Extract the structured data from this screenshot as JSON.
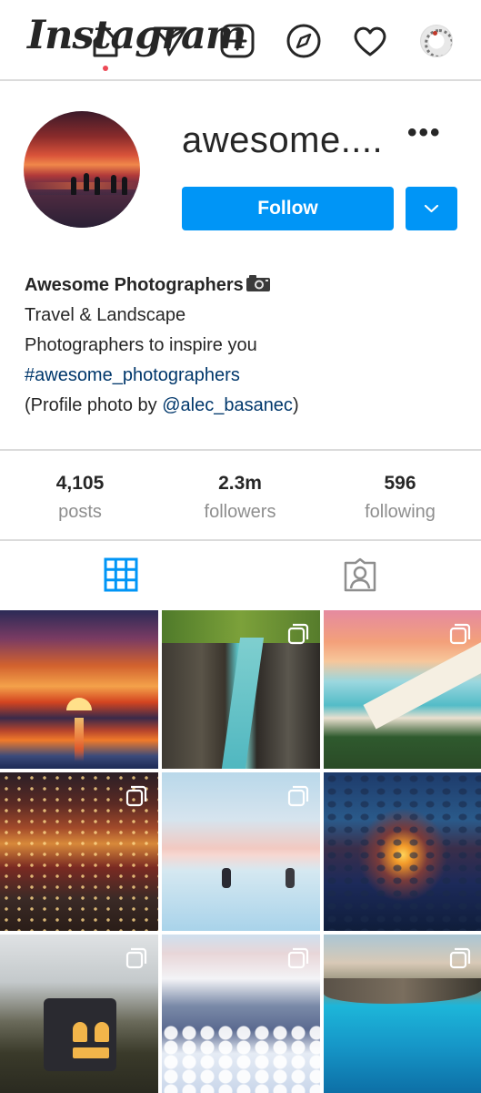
{
  "app": {
    "logo_text": "Instagram"
  },
  "nav": {
    "icons": [
      "home-icon",
      "direct-icon",
      "new-post-icon",
      "explore-icon",
      "activity-icon",
      "profile-avatar"
    ]
  },
  "profile": {
    "username": "awesome....",
    "more": "•••",
    "follow_label": "Follow",
    "bio": {
      "name": "Awesome Photographers",
      "line1": "Travel & Landscape",
      "line2": "Photographers to inspire you",
      "hashtag": "#awesome_photographers",
      "credit_prefix": "(Profile photo by ",
      "credit_handle": "@alec_basanec",
      "credit_suffix": ")"
    }
  },
  "stats": [
    {
      "value": "4,105",
      "label": "posts"
    },
    {
      "value": "2.3m",
      "label": "followers"
    },
    {
      "value": "596",
      "label": "following"
    }
  ],
  "tabs": [
    "grid-tab",
    "tagged-tab"
  ],
  "colors": {
    "follow": "#0095f6",
    "link": "#00376b",
    "muted": "#8e8e8e",
    "divider": "#dbdbdb",
    "notif": "#ed4956"
  }
}
